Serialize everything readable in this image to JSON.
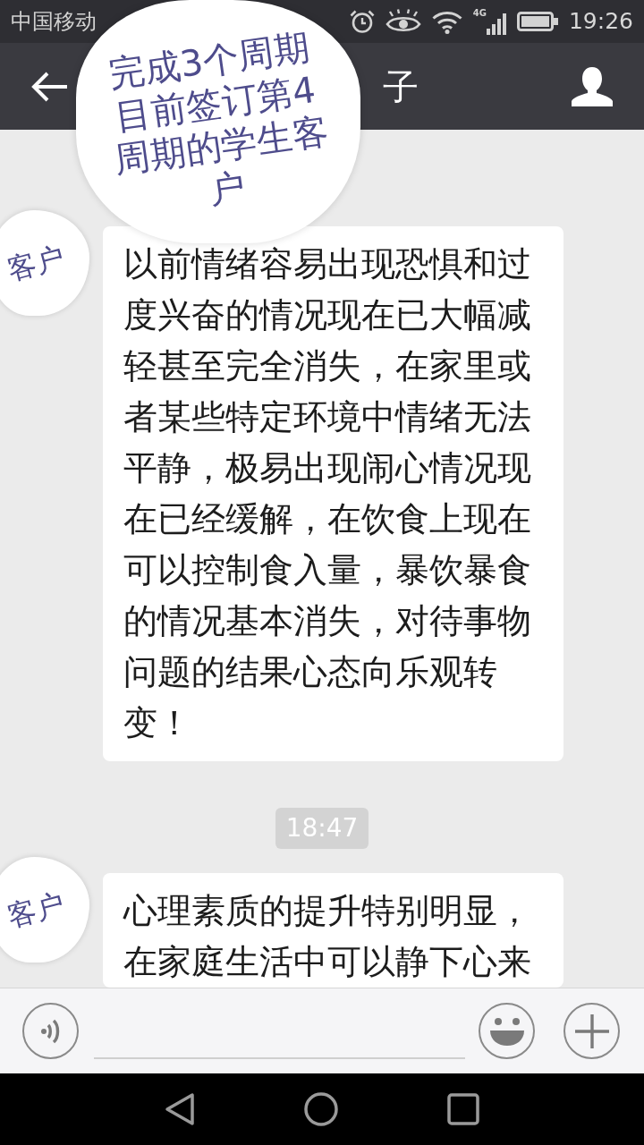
{
  "status_bar": {
    "carrier": "中国移动",
    "network": "4G",
    "time": "19:26"
  },
  "title_bar": {
    "title": "子"
  },
  "callout": {
    "text": "完成3个周期目前签订第4周期的学生客户"
  },
  "messages": [
    {
      "kind": "text",
      "tag": "客户",
      "text": "以前情绪容易出现恐惧和过度兴奋的情况现在已大幅减轻甚至完全消失，在家里或者某些特定环境中情绪无法平静，极易出现闹心情况现在已经缓解，在饮食上现在可以控制食入量，暴饮暴食的情况基本消失，对待事物问题的结果心态向乐观转变！"
    },
    {
      "kind": "time",
      "text": "18:47"
    },
    {
      "kind": "text",
      "tag": "客户",
      "text": "心理素质的提升特别明显，在家庭生活中可以静下心来"
    }
  ]
}
